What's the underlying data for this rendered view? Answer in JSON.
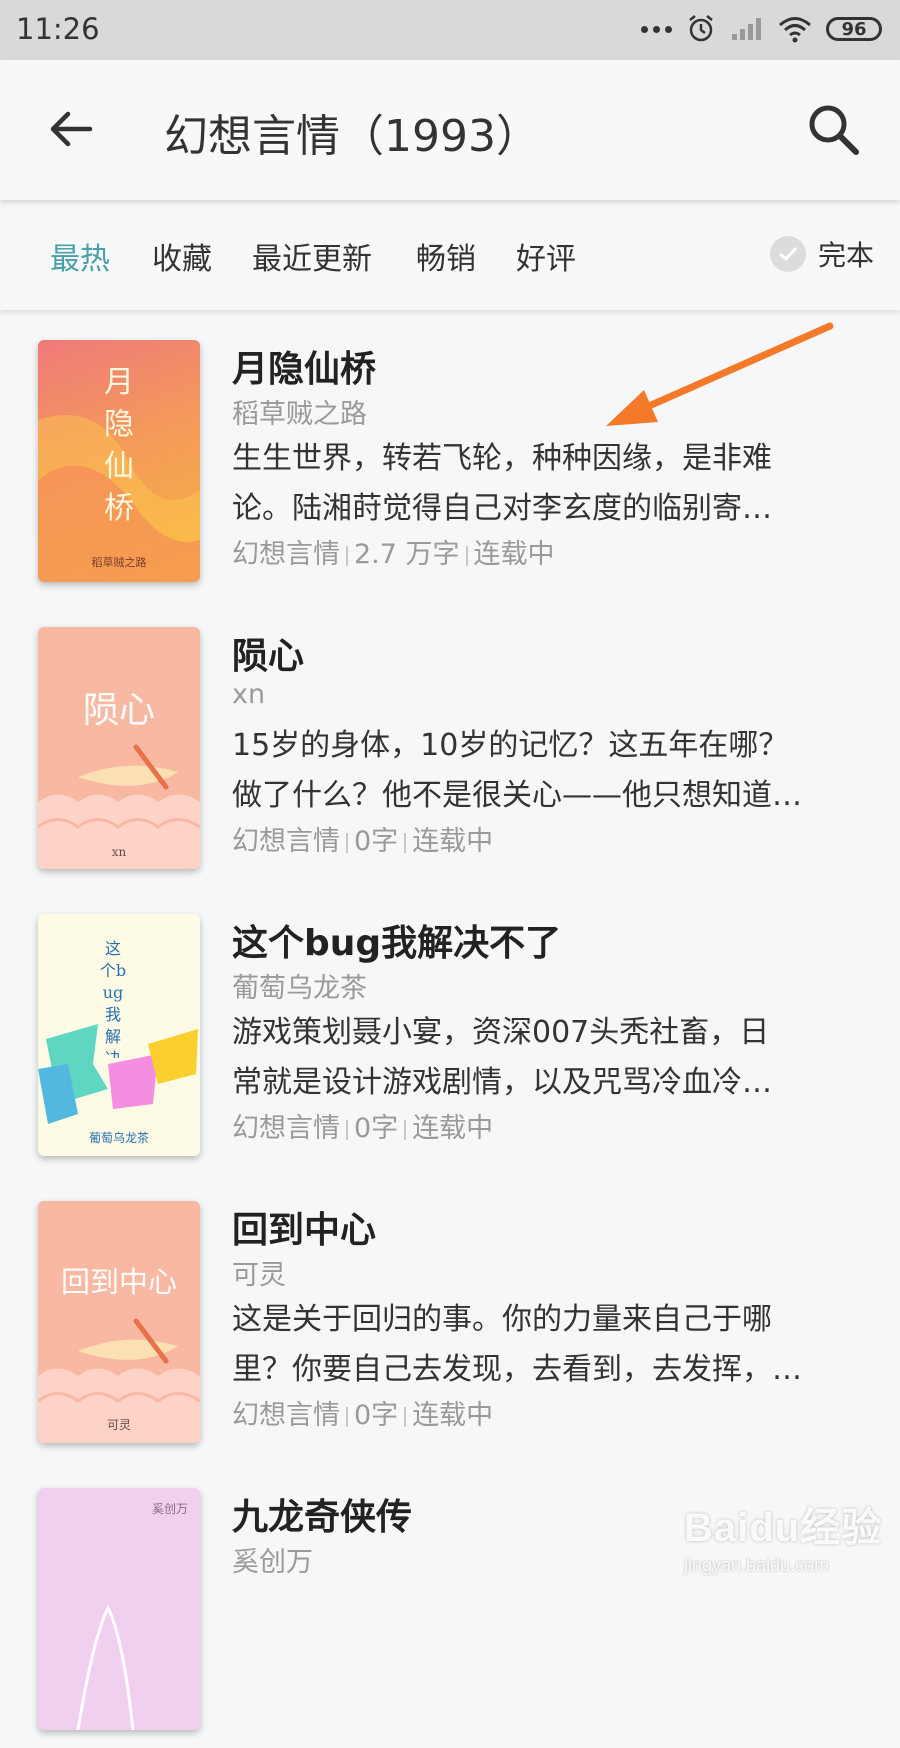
{
  "status_bar": {
    "time": "11:26",
    "battery": "96"
  },
  "header": {
    "title": "幻想言情（1993）"
  },
  "filters": {
    "tabs": [
      "最热",
      "收藏",
      "最近更新",
      "畅销",
      "好评"
    ],
    "active_tab": "最热",
    "complete_label": "完本"
  },
  "books": [
    {
      "title": "月隐仙桥",
      "author": "稻草贼之路",
      "desc_line1": "生生世界，转若飞轮，种种因缘，是非难",
      "desc_line2": "论。陆湘莳觉得自己对李玄度的临别寄…",
      "category": "幻想言情",
      "words": "2.7 万字",
      "status": "连载中",
      "cover_text": "月隐仙桥",
      "cover_author": "稻草贼之路",
      "cover_color": "#f2a15a"
    },
    {
      "title": "陨心",
      "author": "xn",
      "desc_line1": "15岁的身体，10岁的记忆？这五年在哪？",
      "desc_line2": "做了什么？他不是很关心——他只想知道…",
      "category": "幻想言情",
      "words": "0字",
      "status": "连载中",
      "cover_text": "陨心",
      "cover_author": "xn",
      "cover_color": "#f9b8a2"
    },
    {
      "title": "这个bug我解决不了",
      "author": "葡萄乌龙茶",
      "desc_line1": "游戏策划聂小宴，资深007头秃社畜，日",
      "desc_line2": "常就是设计游戏剧情，以及咒骂冷血冷…",
      "category": "幻想言情",
      "words": "0字",
      "status": "连载中",
      "cover_text": "这个bug我解决不了",
      "cover_author": "葡萄乌龙茶",
      "cover_color": "#fdfbe6"
    },
    {
      "title": "回到中心",
      "author": "可灵",
      "desc_line1": "这是关于回归的事。你的力量来自己于哪",
      "desc_line2": "里？你要自己去发现，去看到，去发挥，…",
      "category": "幻想言情",
      "words": "0字",
      "status": "连载中",
      "cover_text": "回到中心",
      "cover_author": "可灵",
      "cover_color": "#f9b8a2"
    },
    {
      "title": "九龙奇侠传",
      "author": "奚创万",
      "cover_author": "奚创万",
      "cover_color": "#f1d0ef"
    }
  ],
  "watermark": {
    "brand": "Baidu经验",
    "url": "jingyan.baidu.com"
  }
}
